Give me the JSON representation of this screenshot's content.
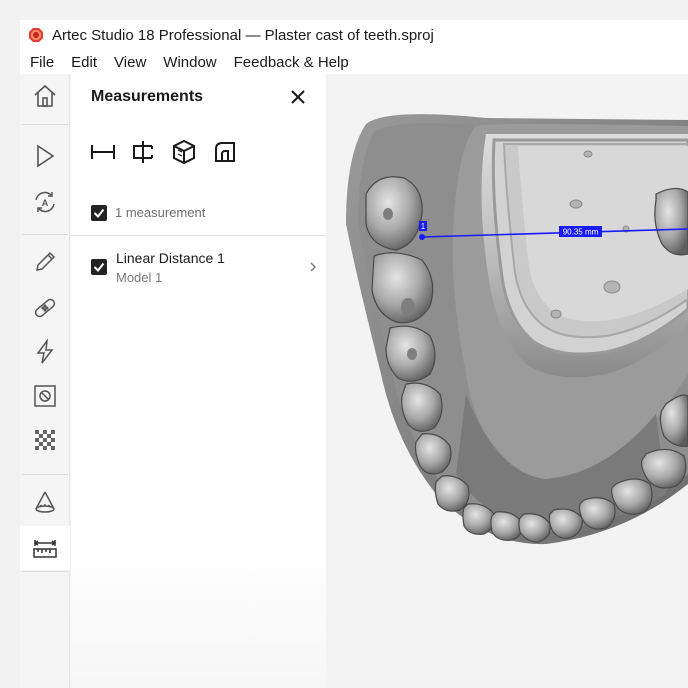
{
  "window": {
    "title": "Artec Studio 18 Professional — Plaster cast of teeth.sproj"
  },
  "menu": {
    "items": [
      "File",
      "Edit",
      "View",
      "Window",
      "Feedback & Help"
    ]
  },
  "toolbar": {
    "icons": [
      "home-icon",
      "play-icon",
      "autopilot-icon",
      "pencil-icon",
      "bandage-icon",
      "lightning-icon",
      "prohibited-icon",
      "texture-icon",
      "cone-icon",
      "measure-ruler-icon"
    ],
    "active": "measure-ruler-icon"
  },
  "panel": {
    "title": "Measurements",
    "tools": [
      "linear-distance-icon",
      "section-icon",
      "surface-area-icon",
      "geodesic-icon"
    ],
    "count_label": "1 measurement",
    "items": [
      {
        "title": "Linear Distance 1",
        "subtitle": "Model 1",
        "checked": true
      }
    ]
  },
  "viewport": {
    "measure_label": "90.35 mm",
    "point_label": "1",
    "accent": "#1a1aff"
  }
}
